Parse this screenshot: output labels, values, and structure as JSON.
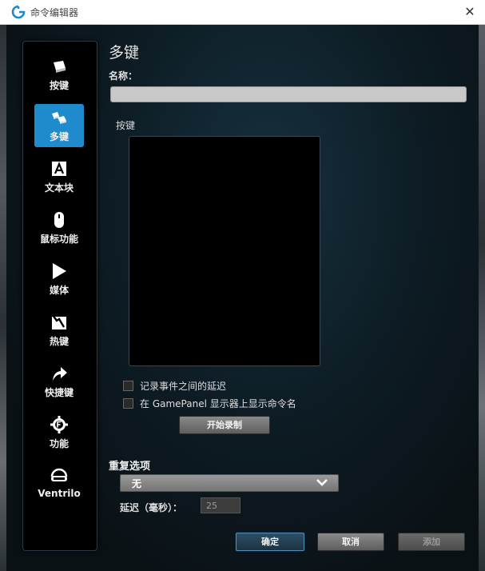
{
  "window": {
    "title": "命令编辑器"
  },
  "sidebar": {
    "items": [
      {
        "label": "按键",
        "icon": "key-icon"
      },
      {
        "label": "多键",
        "icon": "multi-key-icon"
      },
      {
        "label": "文本块",
        "icon": "text-block-icon"
      },
      {
        "label": "鼠标功能",
        "icon": "mouse-icon"
      },
      {
        "label": "媒体",
        "icon": "play-icon"
      },
      {
        "label": "热键",
        "icon": "hotkey-icon"
      },
      {
        "label": "快捷键",
        "icon": "shortcut-arrow-icon"
      },
      {
        "label": "功能",
        "icon": "function-gear-icon"
      },
      {
        "label": "Ventrilo",
        "icon": "headset-icon"
      }
    ],
    "active_index": 1,
    "active_color": "#1f8bcc"
  },
  "main": {
    "heading": "多键",
    "name_label": "名称：",
    "name_value": "",
    "keys_label": "按键",
    "options": {
      "record_delays_label": "记录事件之间的延迟",
      "show_name_label": "在 GamePanel 显示器上显示命令名"
    },
    "start_recording_label": "开始录制",
    "repeat": {
      "label": "重复选项",
      "selected": "无",
      "delay_label": "延迟（毫秒）：",
      "delay_value": "25"
    }
  },
  "footer": {
    "ok_label": "确定",
    "cancel_label": "取消",
    "add_label": "添加"
  }
}
